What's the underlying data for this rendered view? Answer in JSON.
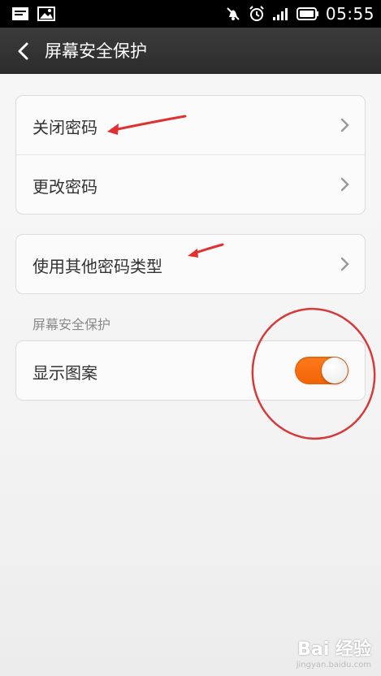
{
  "status_bar": {
    "time": "05:55",
    "left_icons": [
      "notification-icon",
      "image-icon"
    ],
    "right_icons": [
      "mute-icon",
      "alarm-icon",
      "signal-icon",
      "battery-icon"
    ]
  },
  "title_bar": {
    "title": "屏幕安全保护"
  },
  "groups": [
    {
      "rows": [
        {
          "label": "关闭密码"
        },
        {
          "label": "更改密码"
        }
      ]
    },
    {
      "rows": [
        {
          "label": "使用其他密码类型"
        }
      ]
    }
  ],
  "section_header": "屏幕安全保护",
  "toggle_row": {
    "label": "显示图案",
    "state": "on"
  },
  "colors": {
    "toggle_on": "#f26a0c",
    "annotation": "#e03030"
  },
  "watermark": {
    "main": "Bai 经验",
    "sub": "jingyan.baidu.com"
  }
}
